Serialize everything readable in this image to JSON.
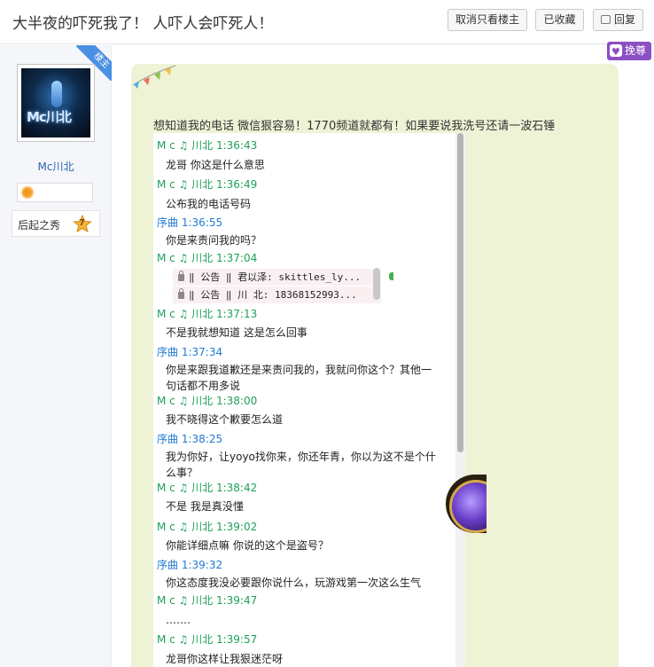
{
  "header": {
    "title": "大半夜的吓死我了！ 人吓人会吓死人！",
    "only_op_label": "取消只看楼主",
    "favorited_label": "已收藏",
    "reply_label": "回复"
  },
  "author": {
    "op_ribbon": "楼主",
    "avatar_text": "Mc川北",
    "username": "Mc川北",
    "level_name": "后起之秀",
    "level_num": "7"
  },
  "post": {
    "tip_label": "挽尊",
    "text": "想知道我的电话 微信狠容易！1770频道就都有！如果要说我洗号还请一波石锤"
  },
  "chat": {
    "messages": [
      {
        "sender": "M c ♫  川北",
        "time": "1:36:43",
        "text": "龙哥 你这是什么意思"
      },
      {
        "sender": "M c ♫  川北",
        "time": "1:36:49",
        "text": "公布我的电话号码"
      },
      {
        "sender": "序曲",
        "time": "1:36:55",
        "text": "你是来责问我的吗？"
      },
      {
        "sender": "M c ♫  川北",
        "time": "1:37:04",
        "text": ""
      },
      {
        "sender": "M c ♫  川北",
        "time": "1:37:13",
        "text": "不是我就想知道 这是怎么回事"
      },
      {
        "sender": "序曲",
        "time": "1:37:34",
        "text": "你是来跟我道歉还是来责问我的，我就问你这个？其他一句话都不用多说"
      },
      {
        "sender": "M c ♫  川北",
        "time": "1:38:00",
        "text": "我不晓得这个歉要怎么道"
      },
      {
        "sender": "序曲",
        "time": "1:38:25",
        "text": "我为你好，让yoyo找你来，你还年青，你以为这不是个什么事？"
      },
      {
        "sender": "M c ♫  川北",
        "time": "1:38:42",
        "text": "不是 我是真没懂"
      },
      {
        "sender": "M c ♫  川北",
        "time": "1:39:02",
        "text": "你能详细点嘛  你说的这个是盗号？"
      },
      {
        "sender": "序曲",
        "time": "1:39:32",
        "text": "你这态度我没必要跟你说什么，玩游戏第一次这么生气"
      },
      {
        "sender": "M c ♫  川北",
        "time": "1:39:47",
        "text": "……."
      },
      {
        "sender": "M c ♫  川北",
        "time": "1:39:57",
        "text": "龙哥你这样让我狠迷茫呀"
      }
    ],
    "notices": [
      "‖ 公告 ‖  君以泽: skittles_ly...",
      "‖ 公告 ‖  川  北: 18368152993..."
    ]
  }
}
